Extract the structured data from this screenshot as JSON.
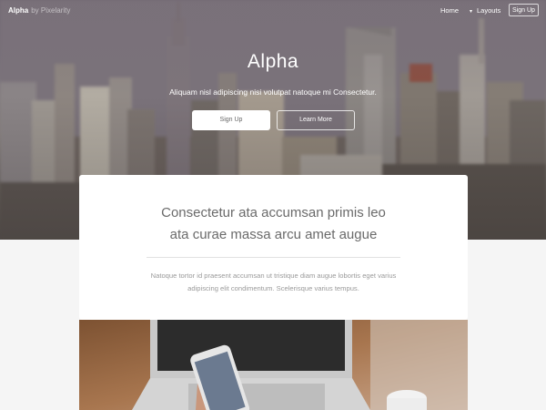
{
  "nav": {
    "brand_name": "Alpha",
    "brand_by": "by Pixelarity",
    "home_label": "Home",
    "layouts_label": "Layouts",
    "layouts_icon": "chevron-down-icon",
    "signup_label": "Sign Up"
  },
  "hero": {
    "title": "Alpha",
    "subtitle": "Aliquam nisl adipiscing nisi volutpat natoque mi Consectetur.",
    "primary_button": "Sign Up",
    "secondary_button": "Learn More"
  },
  "card": {
    "title_line1": "Consectetur ata accumsan primis leo",
    "title_line2": "ata curae massa arcu amet augue",
    "text_line1": "Natoque tortor id praesent accumsan ut tristique diam augue lobortis eget varius",
    "text_line2": "adipiscing elit condimentum. Scelerisque varius tempus."
  },
  "colors": {
    "page_background": "#f5f5f5",
    "card_background": "#ffffff",
    "hero_text": "#ffffff",
    "card_title": "#6a6a6a",
    "card_text": "#9a9a9a"
  }
}
